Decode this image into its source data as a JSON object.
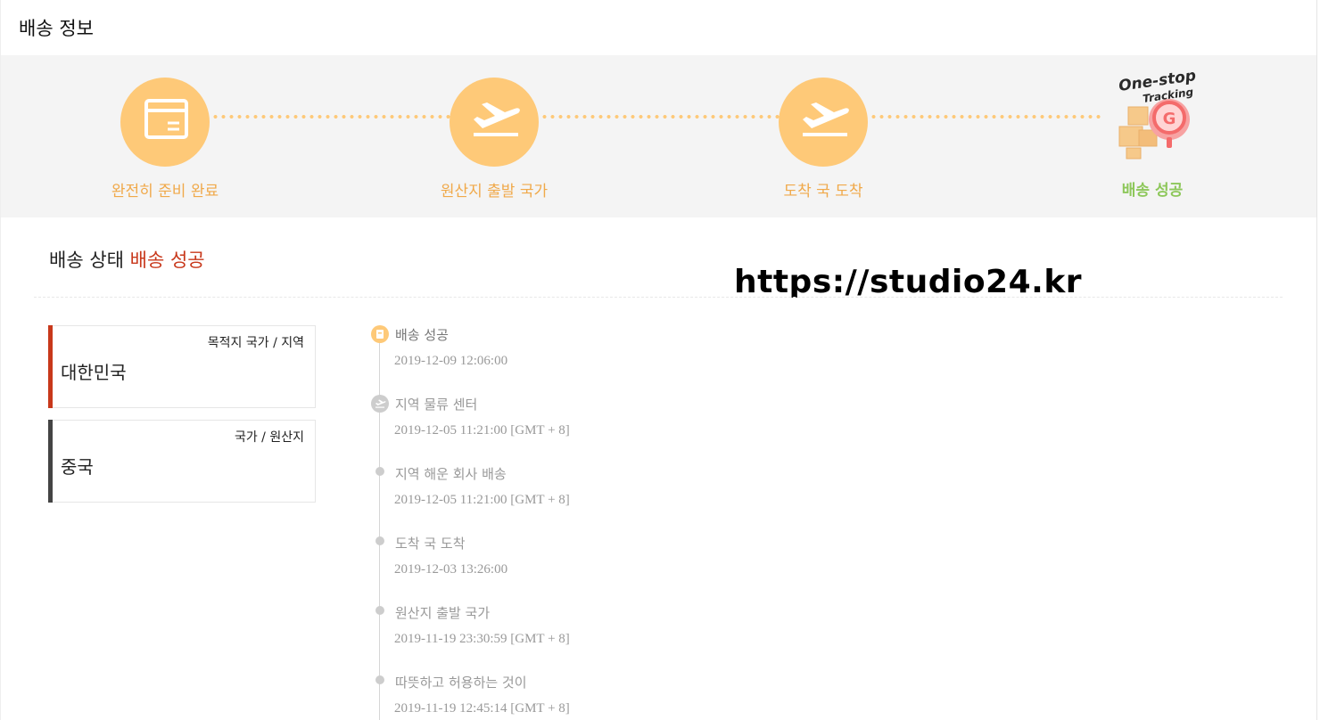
{
  "header": {
    "title": "배송 정보"
  },
  "steps": [
    {
      "label": "완전히 준비 완료",
      "icon": "package-icon"
    },
    {
      "label": "원산지 출발 국가",
      "icon": "plane-takeoff-icon"
    },
    {
      "label": "도착 국 도착",
      "icon": "plane-takeoff-icon"
    },
    {
      "label": "배송 성공",
      "icon": "one-stop-tracking-logo"
    }
  ],
  "logo": {
    "line1": "One-stop",
    "line2": "Tracking"
  },
  "status": {
    "label": "배송 상태",
    "value": "배송 성공"
  },
  "watermark": "https://studio24.kr",
  "locations": [
    {
      "caption": "목적지 국가 / 지역",
      "value": "대한민국",
      "bar_color": "#c8381b"
    },
    {
      "caption": "국가 / 원산지",
      "value": "중국",
      "bar_color": "#444444"
    }
  ],
  "timeline": [
    {
      "title": "배송 성공",
      "time": "2019-12-09 12:06:00"
    },
    {
      "title": "지역 물류 센터",
      "time": "2019-12-05 11:21:00 [GMT + 8]"
    },
    {
      "title": "지역 해운 회사 배송",
      "time": "2019-12-05 11:21:00 [GMT + 8]"
    },
    {
      "title": "도착 국 도착",
      "time": "2019-12-03 13:26:00"
    },
    {
      "title": "원산지 출발 국가",
      "time": "2019-11-19 23:30:59 [GMT + 8]"
    },
    {
      "title": "따뜻하고 허용하는 것이",
      "time": "2019-11-19 12:45:14 [GMT + 8]"
    }
  ],
  "colors": {
    "accent": "#fec978",
    "step_text": "#f0a94a",
    "success": "#8dc75a",
    "status_red": "#c8381b"
  }
}
